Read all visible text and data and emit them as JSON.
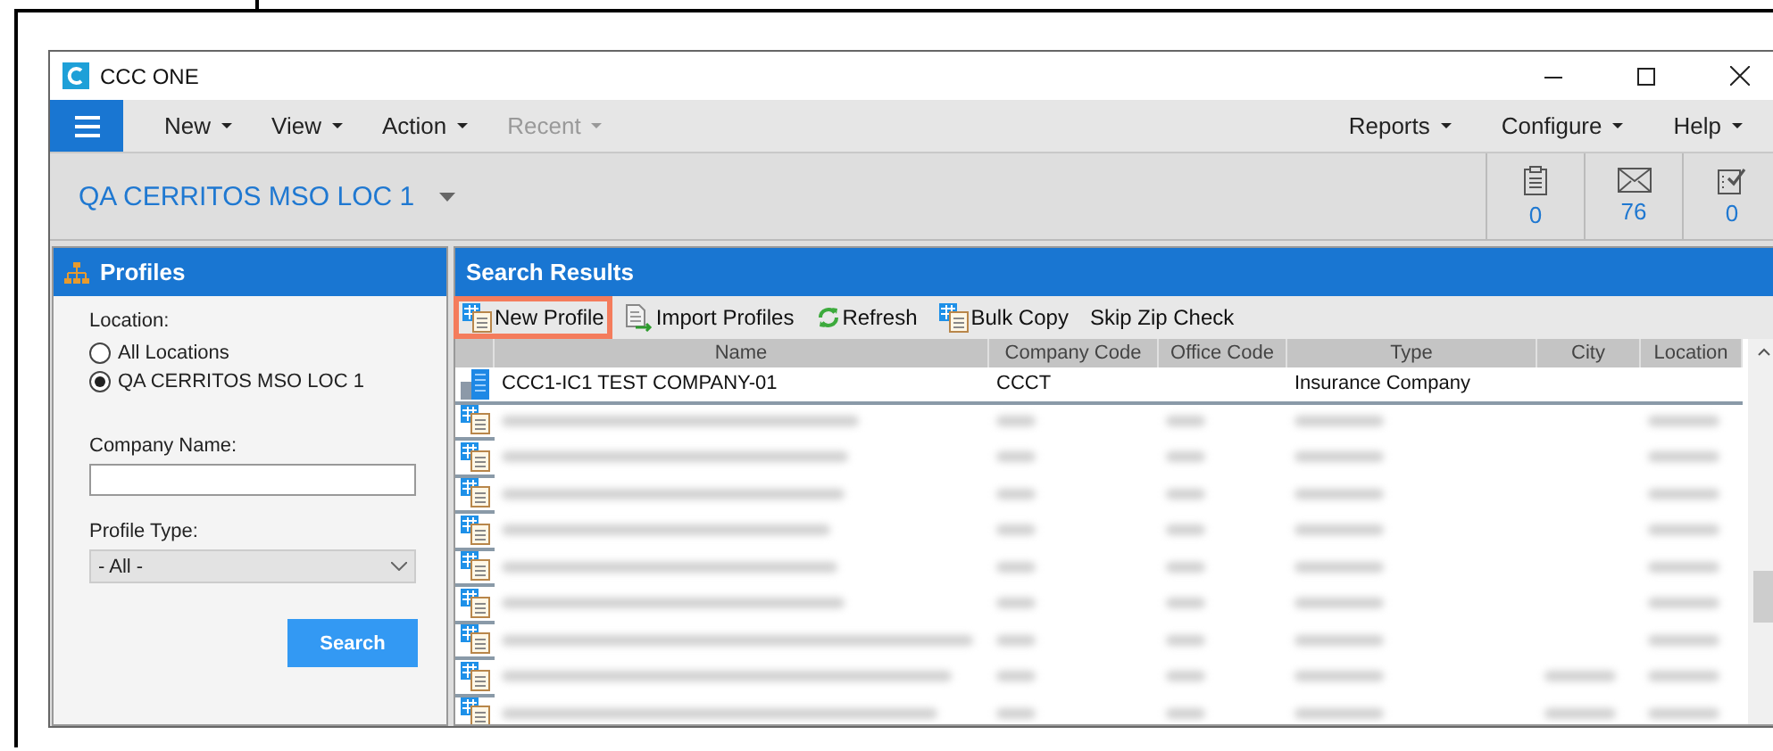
{
  "window": {
    "title": "CCC ONE"
  },
  "menu": {
    "left": [
      {
        "label": "New",
        "disabled": false
      },
      {
        "label": "View",
        "disabled": false
      },
      {
        "label": "Action",
        "disabled": false
      },
      {
        "label": "Recent",
        "disabled": true
      }
    ],
    "right": [
      {
        "label": "Reports"
      },
      {
        "label": "Configure"
      },
      {
        "label": "Help"
      }
    ]
  },
  "location_bar": {
    "location": "QA CERRITOS MSO LOC 1"
  },
  "counters": [
    {
      "kind": "clipboard",
      "count": "0"
    },
    {
      "kind": "mail",
      "count": "76"
    },
    {
      "kind": "checklist",
      "count": "0"
    }
  ],
  "profiles_panel": {
    "title": "Profiles",
    "location_label": "Location:",
    "locations": [
      {
        "label": "All Locations",
        "selected": false
      },
      {
        "label": "QA CERRITOS MSO LOC 1",
        "selected": true
      }
    ],
    "company_name_label": "Company Name:",
    "profile_type_label": "Profile Type:",
    "profile_type": "- All -",
    "search_button": "Search"
  },
  "results_panel": {
    "title": "Search Results",
    "toolbar": [
      {
        "kind": "new",
        "label": "New Profile",
        "highlighted": true
      },
      {
        "kind": "import",
        "label": "Import Profiles",
        "highlighted": false
      },
      {
        "kind": "refresh",
        "label": "Refresh",
        "highlighted": false
      },
      {
        "kind": "new",
        "label": "Bulk Copy",
        "highlighted": false
      },
      {
        "kind": "none",
        "label": "Skip Zip Check",
        "highlighted": false
      }
    ],
    "columns": [
      "Name",
      "Company Code",
      "Office Code",
      "Type",
      "City",
      "Location"
    ],
    "rows": [
      {
        "kind": "company",
        "cells": [
          "CCC1-IC1 TEST COMPANY-01",
          "CCCT",
          "",
          "Insurance Company",
          "",
          ""
        ]
      },
      {
        "kind": "blurred",
        "city": false
      },
      {
        "kind": "blurred",
        "city": false
      },
      {
        "kind": "blurred",
        "city": false
      },
      {
        "kind": "blurred",
        "city": false
      },
      {
        "kind": "blurred",
        "city": false
      },
      {
        "kind": "blurred",
        "city": false
      },
      {
        "kind": "blurred",
        "city": false
      },
      {
        "kind": "blurred",
        "city": true
      },
      {
        "kind": "blurred",
        "city": true
      }
    ]
  }
}
